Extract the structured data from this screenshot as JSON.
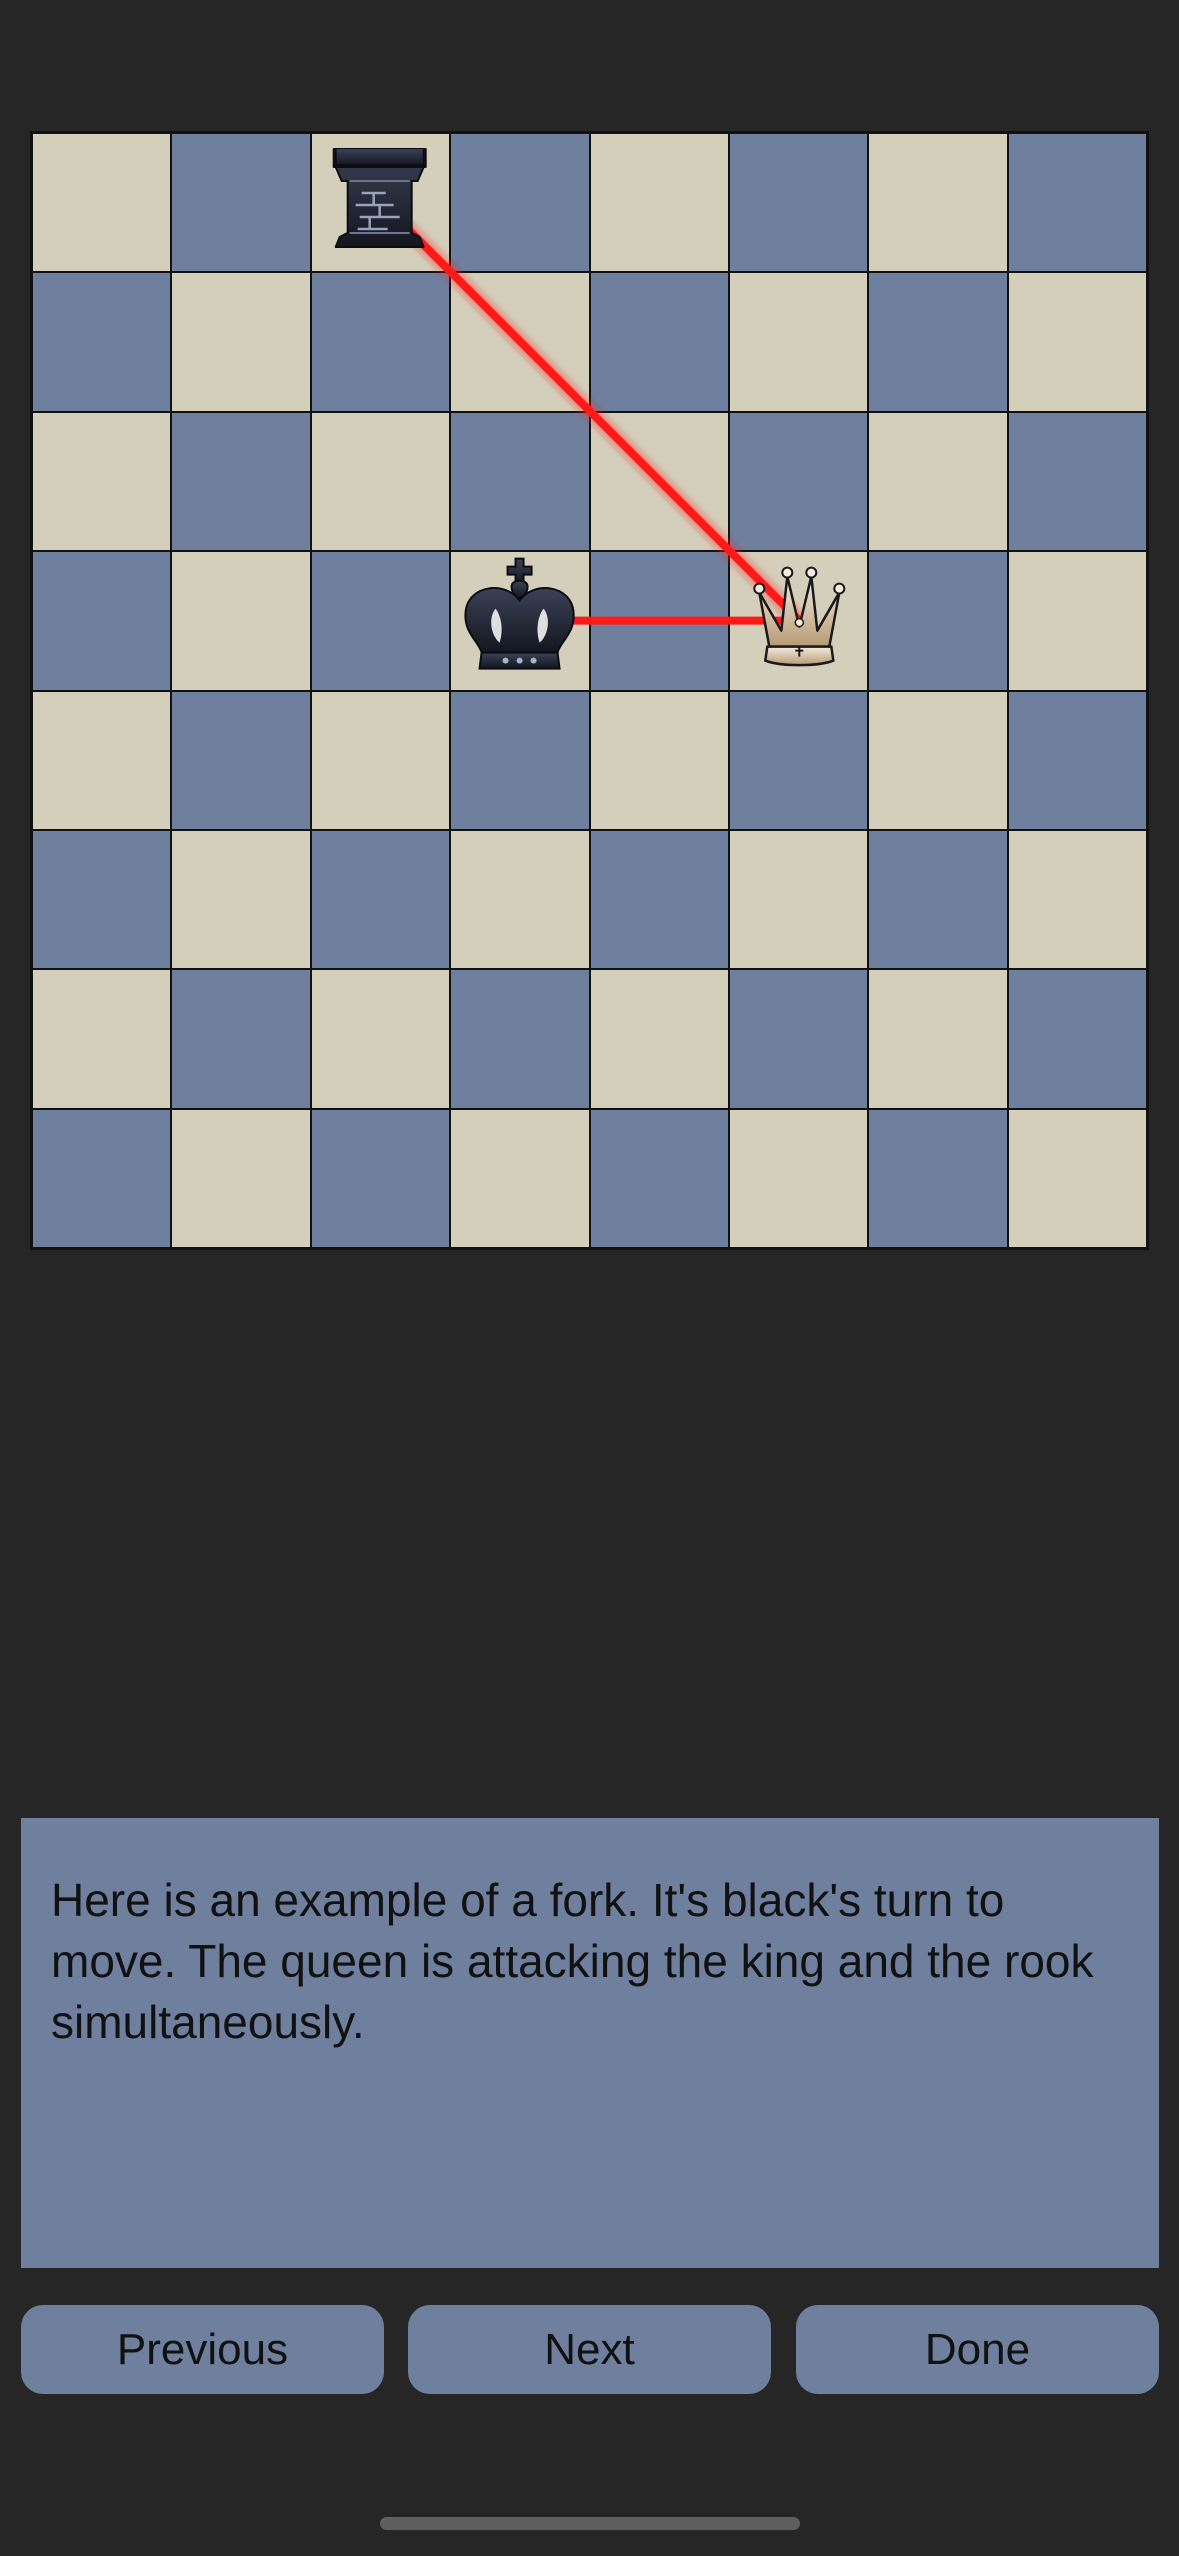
{
  "board": {
    "light_color": "#d4cfbb",
    "dark_color": "#6e809d",
    "pieces": [
      {
        "name": "black-rook",
        "square": "c8",
        "color": "black"
      },
      {
        "name": "black-king",
        "square": "d5",
        "color": "black"
      },
      {
        "name": "white-queen",
        "square": "f5",
        "color": "white"
      }
    ],
    "attack_lines": [
      {
        "from": "f5",
        "to": "c8",
        "color": "#ff1a1a"
      },
      {
        "from": "f5",
        "to": "d5",
        "color": "#ff1a1a"
      }
    ]
  },
  "lesson": {
    "text": "Here is an example of a fork. It's black's turn to move. The queen is attacking the king and the rook simultaneously."
  },
  "buttons": {
    "previous": "Previous",
    "next": "Next",
    "done": "Done"
  }
}
